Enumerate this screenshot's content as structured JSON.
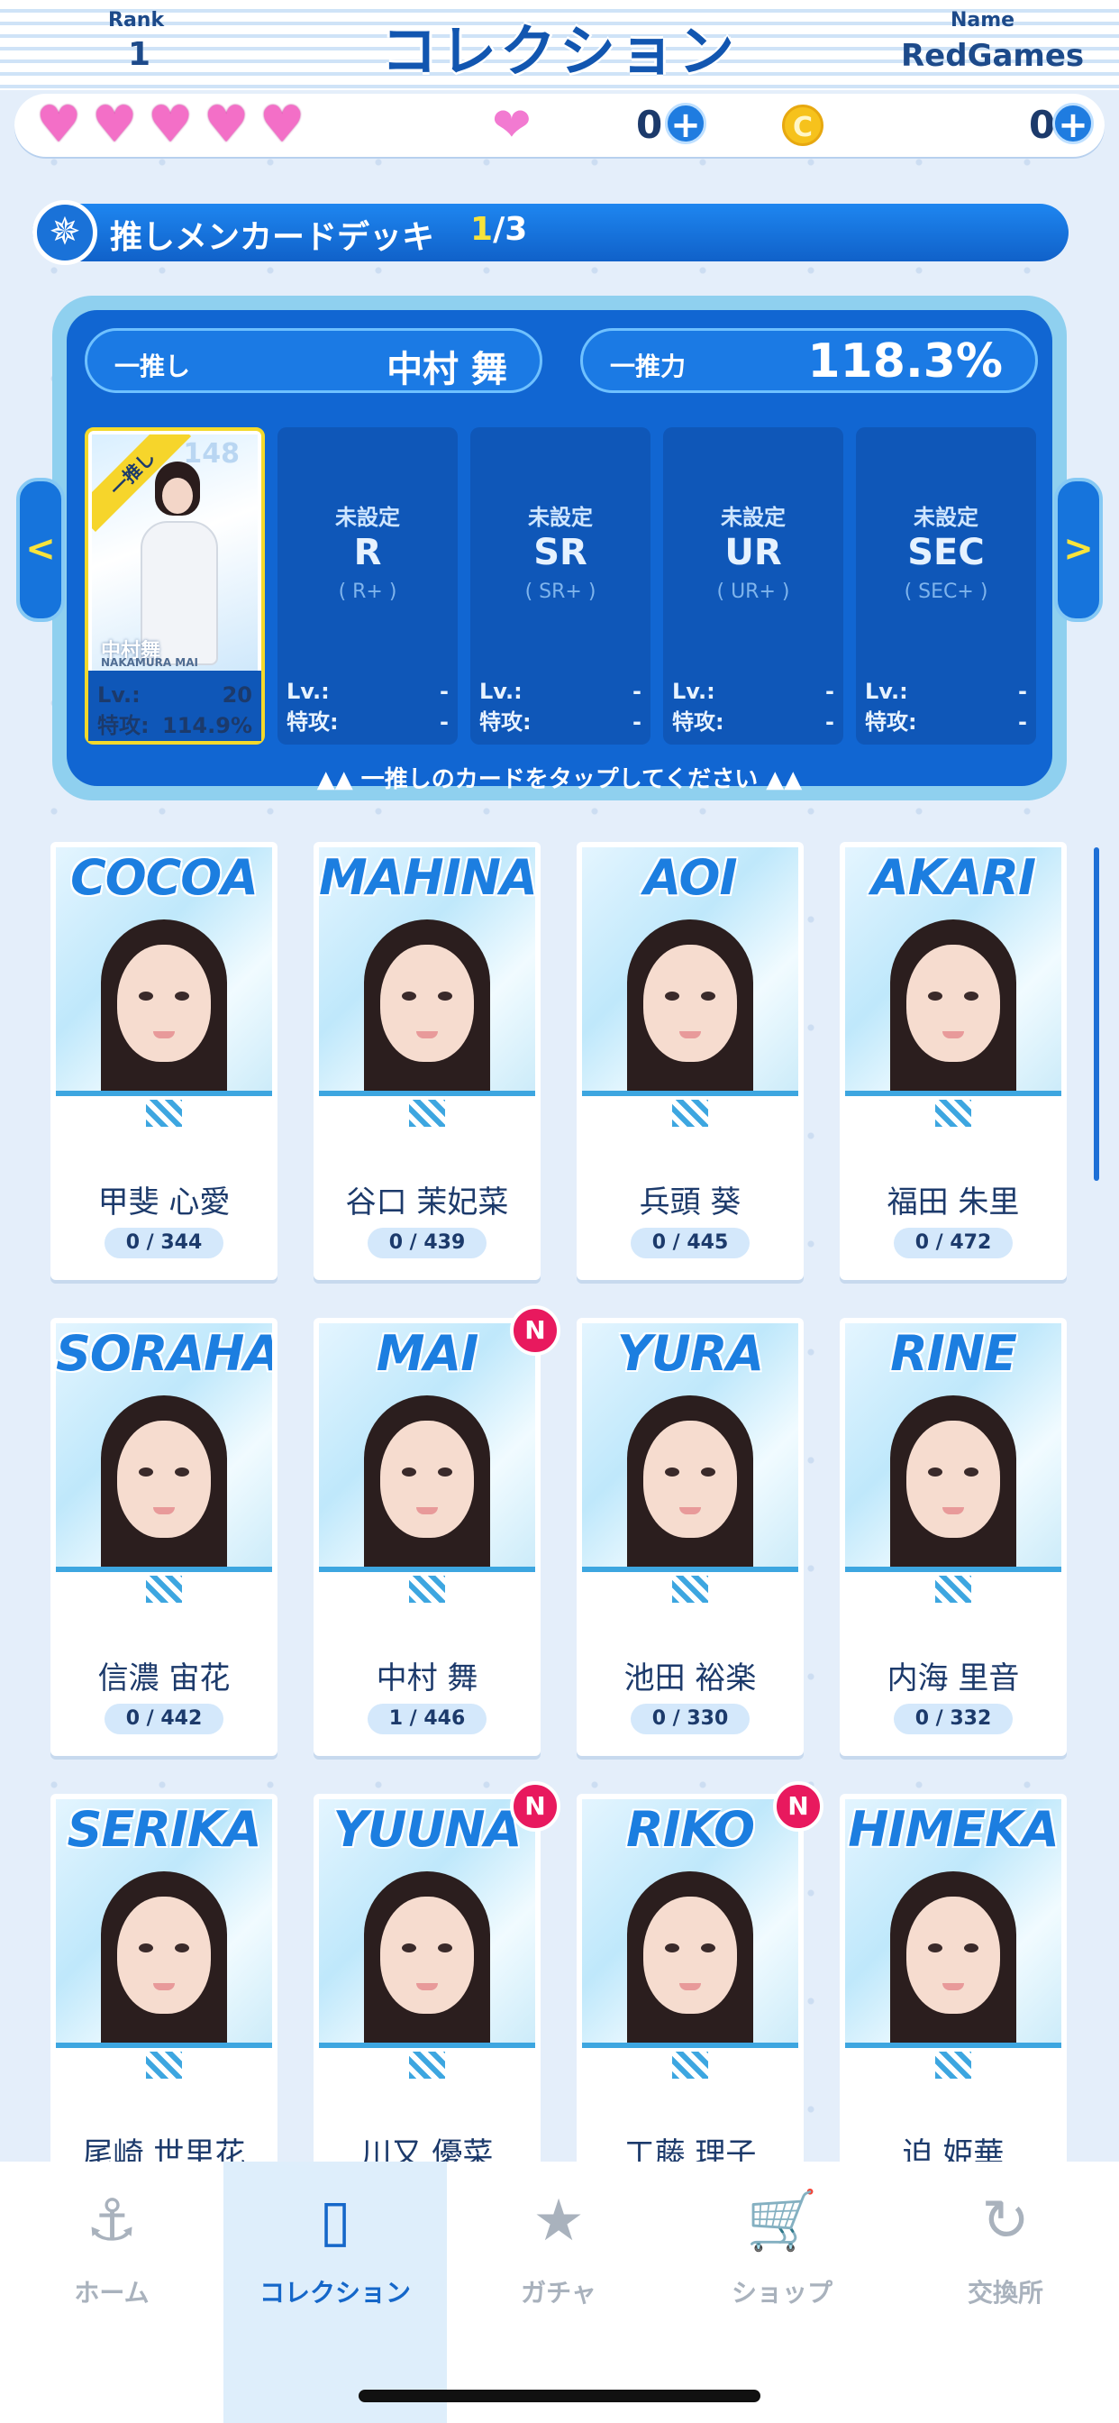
{
  "header": {
    "rank_label": "Rank",
    "rank_value": "1",
    "title": "コレクション",
    "name_label": "Name",
    "name_value": "RedGames"
  },
  "status": {
    "hearts_icon": "heart-icon",
    "gem_count": "0",
    "coin_symbol": "C",
    "coin_count": "0",
    "plus_symbol": "+"
  },
  "deck": {
    "title": "推しメンカードデッキ",
    "current": "1",
    "total": "/3",
    "oshi_label": "一推し",
    "oshi_name": "中村 舞",
    "power_label": "一推力",
    "power_value": "118.3%",
    "hint": "▲▲ 一推しのカードをタップしてください ▲▲",
    "filled_card": {
      "ribbon": "一推し",
      "number": "148",
      "name_jp": "中村舞",
      "name_en": "NAKAMURA MAI",
      "lv_label": "Lv.:",
      "lv_value": "20",
      "atk_label": "特攻:",
      "atk_value": "114.9%"
    },
    "empty_slots": [
      {
        "label": "未設定",
        "rarity": "R",
        "sub": "( R+ )",
        "lv_label": "Lv.:",
        "lv_value": "-",
        "atk_label": "特攻:",
        "atk_value": "-"
      },
      {
        "label": "未設定",
        "rarity": "SR",
        "sub": "( SR+ )",
        "lv_label": "Lv.:",
        "lv_value": "-",
        "atk_label": "特攻:",
        "atk_value": "-"
      },
      {
        "label": "未設定",
        "rarity": "UR",
        "sub": "( UR+ )",
        "lv_label": "Lv.:",
        "lv_value": "-",
        "atk_label": "特攻:",
        "atk_value": "-"
      },
      {
        "label": "未設定",
        "rarity": "SEC",
        "sub": "( SEC+ )",
        "lv_label": "Lv.:",
        "lv_value": "-",
        "atk_label": "特攻:",
        "atk_value": "-"
      }
    ],
    "arrow_left": "<",
    "arrow_right": ">"
  },
  "members": [
    {
      "en": "COCOA",
      "name": "甲斐 心愛",
      "count": "0 / 344"
    },
    {
      "en": "MAHINA",
      "name": "谷口 茉妃菜",
      "count": "0 / 439"
    },
    {
      "en": "AOI",
      "name": "兵頭 葵",
      "count": "0 / 445"
    },
    {
      "en": "AKARI",
      "name": "福田 朱里",
      "count": "0 / 472"
    },
    {
      "en": "SORAHA",
      "name": "信濃 宙花",
      "count": "0 / 442"
    },
    {
      "en": "MAI",
      "name": "中村 舞",
      "count": "1 / 446",
      "badge": "N"
    },
    {
      "en": "YURA",
      "name": "池田 裕楽",
      "count": "0 / 330"
    },
    {
      "en": "RINE",
      "name": "内海 里音",
      "count": "0 / 332"
    },
    {
      "en": "SERIKA",
      "name": "尾崎 世里花",
      "count": ""
    },
    {
      "en": "YUUNA",
      "name": "川又 優菜",
      "count": "",
      "badge": "N"
    },
    {
      "en": "RIKO",
      "name": "工藤 理子",
      "count": "",
      "badge": "N"
    },
    {
      "en": "HIMEKA",
      "name": "迫 姫華",
      "count": ""
    }
  ],
  "tabs": [
    {
      "label": "ホーム",
      "icon": "anchor-icon",
      "glyph": "⚓"
    },
    {
      "label": "コレクション",
      "icon": "collection-book-icon",
      "glyph": "▯"
    },
    {
      "label": "ガチャ",
      "icon": "gacha-card-icon",
      "glyph": "★"
    },
    {
      "label": "ショップ",
      "icon": "cart-icon",
      "glyph": "🛒"
    },
    {
      "label": "交換所",
      "icon": "exchange-icon",
      "glyph": "↻"
    }
  ],
  "colors": {
    "accent": "#1567c9",
    "badge": "#e8195e",
    "heart": "#f36fc7",
    "highlight": "#f8e33b"
  }
}
